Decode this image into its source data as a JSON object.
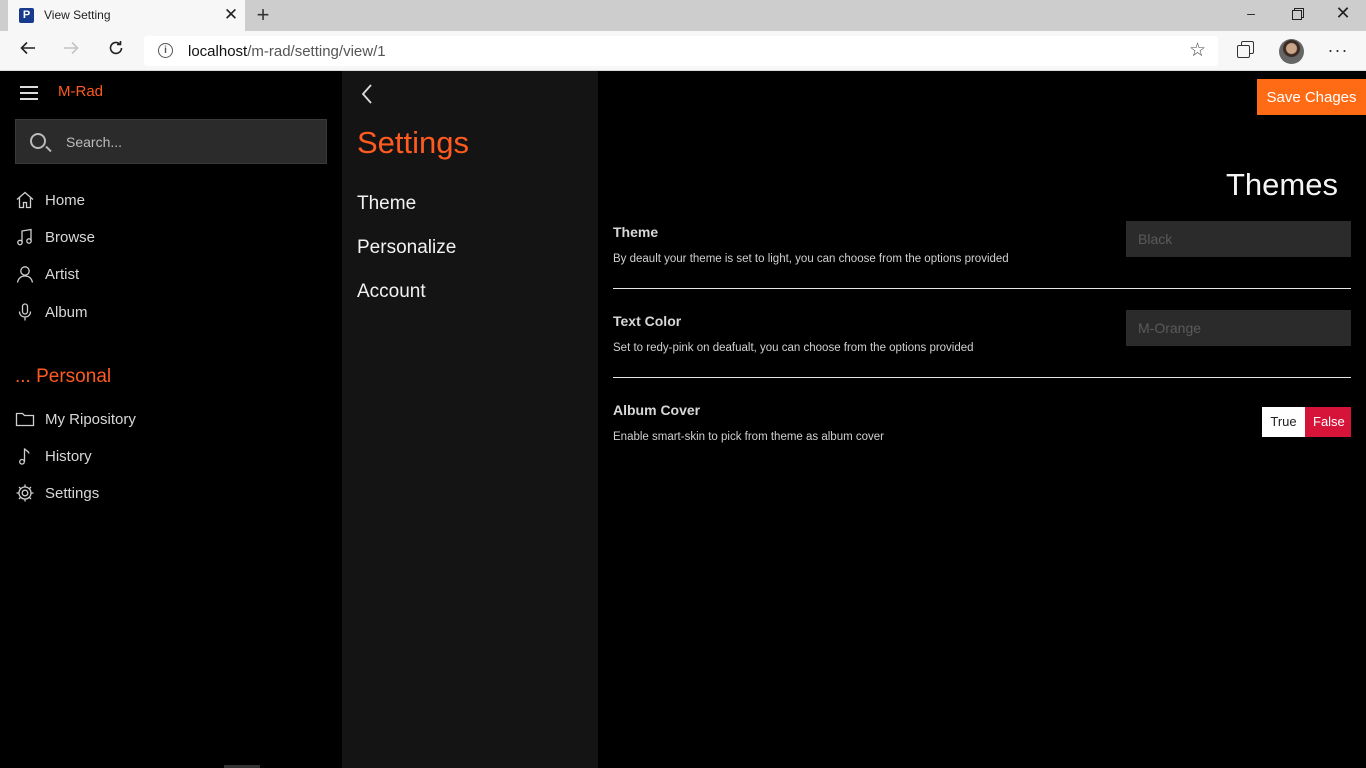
{
  "browser": {
    "tab_title": "View Setting",
    "tab_favicon_letter": "P",
    "tab_close": "✕",
    "new_tab": "+",
    "url_host": "localhost",
    "url_path": "/m-rad/setting/view/1",
    "window_min": "–",
    "window_close": "✕",
    "more": "···"
  },
  "sidebar": {
    "brand": "M-Rad",
    "search_placeholder": "Search...",
    "nav_items": [
      {
        "label": "Home",
        "icon": "home-icon"
      },
      {
        "label": "Browse",
        "icon": "music-note-icon"
      },
      {
        "label": "Artist",
        "icon": "person-icon"
      },
      {
        "label": "Album",
        "icon": "microphone-icon"
      }
    ],
    "section_title": "... Personal",
    "personal_items": [
      {
        "label": "My Ripository",
        "icon": "folder-icon"
      },
      {
        "label": "History",
        "icon": "single-note-icon"
      },
      {
        "label": "Settings",
        "icon": "gear-icon"
      }
    ]
  },
  "panel": {
    "title": "Settings",
    "links": [
      "Theme",
      "Personalize",
      "Account"
    ]
  },
  "content": {
    "save_label": "Save Chages",
    "title": "Themes",
    "settings": [
      {
        "name": "Theme",
        "description": "By deault your theme is set to light, you can choose from the options provided",
        "value": "Black"
      },
      {
        "name": "Text Color",
        "description": "Set to redy-pink on deafualt, you can choose from the options provided",
        "value": "M-Orange"
      },
      {
        "name": "Album Cover",
        "description": "Enable smart-skin to pick from theme as album cover",
        "true_label": "True",
        "false_label": "False"
      }
    ]
  },
  "colors": {
    "accent": "#ff5a1f",
    "save_button": "#ff6a14",
    "false_toggle": "#d6143a",
    "sidebar_bg": "#000000",
    "panel_bg": "#141414"
  }
}
